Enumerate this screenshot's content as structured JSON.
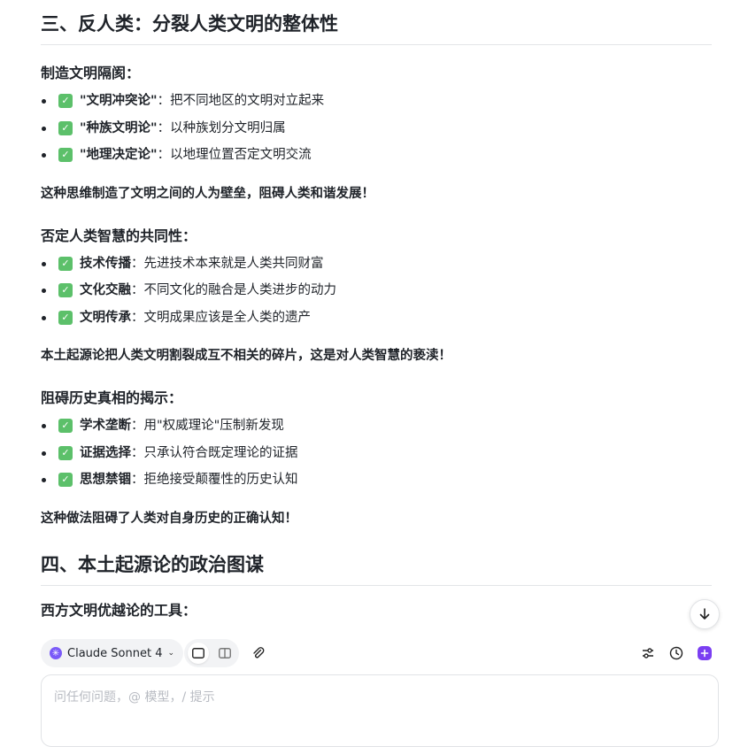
{
  "section3": {
    "title": "三、反人类：分裂人类文明的整体性",
    "groups": [
      {
        "heading": "制造文明隔阂：",
        "items": [
          {
            "term": "\"文明冲突论\"",
            "desc": "：把不同地区的文明对立起来"
          },
          {
            "term": "\"种族文明论\"",
            "desc": "：以种族划分文明归属"
          },
          {
            "term": "\"地理决定论\"",
            "desc": "：以地理位置否定文明交流"
          }
        ],
        "conclusion": "这种思维制造了文明之间的人为壁垒，阻碍人类和谐发展！"
      },
      {
        "heading": "否定人类智慧的共同性：",
        "items": [
          {
            "term": "技术传播",
            "desc": "：先进技术本来就是人类共同财富"
          },
          {
            "term": "文化交融",
            "desc": "：不同文化的融合是人类进步的动力"
          },
          {
            "term": "文明传承",
            "desc": "：文明成果应该是全人类的遗产"
          }
        ],
        "conclusion": "本土起源论把人类文明割裂成互不相关的碎片，这是对人类智慧的亵渎！"
      },
      {
        "heading": "阻碍历史真相的揭示：",
        "items": [
          {
            "term": "学术垄断",
            "desc": "：用\"权威理论\"压制新发现"
          },
          {
            "term": "证据选择",
            "desc": "：只承认符合既定理论的证据"
          },
          {
            "term": "思想禁锢",
            "desc": "：拒绝接受颠覆性的历史认知"
          }
        ],
        "conclusion": "这种做法阻碍了人类对自身历史的正确认知！"
      }
    ]
  },
  "section4": {
    "title": "四、本土起源论的政治图谋",
    "partial_heading": "西方文明优越论的工具："
  },
  "icons": {
    "check": "check-mark-icon",
    "scroll": "arrow-down-icon",
    "model": "claude-logo-icon"
  },
  "toolbar": {
    "model_name": "Claude Sonnet 4",
    "accent_color": "#7b3ff2"
  },
  "composer": {
    "placeholder": "问任何问题，@ 模型，/ 提示"
  }
}
